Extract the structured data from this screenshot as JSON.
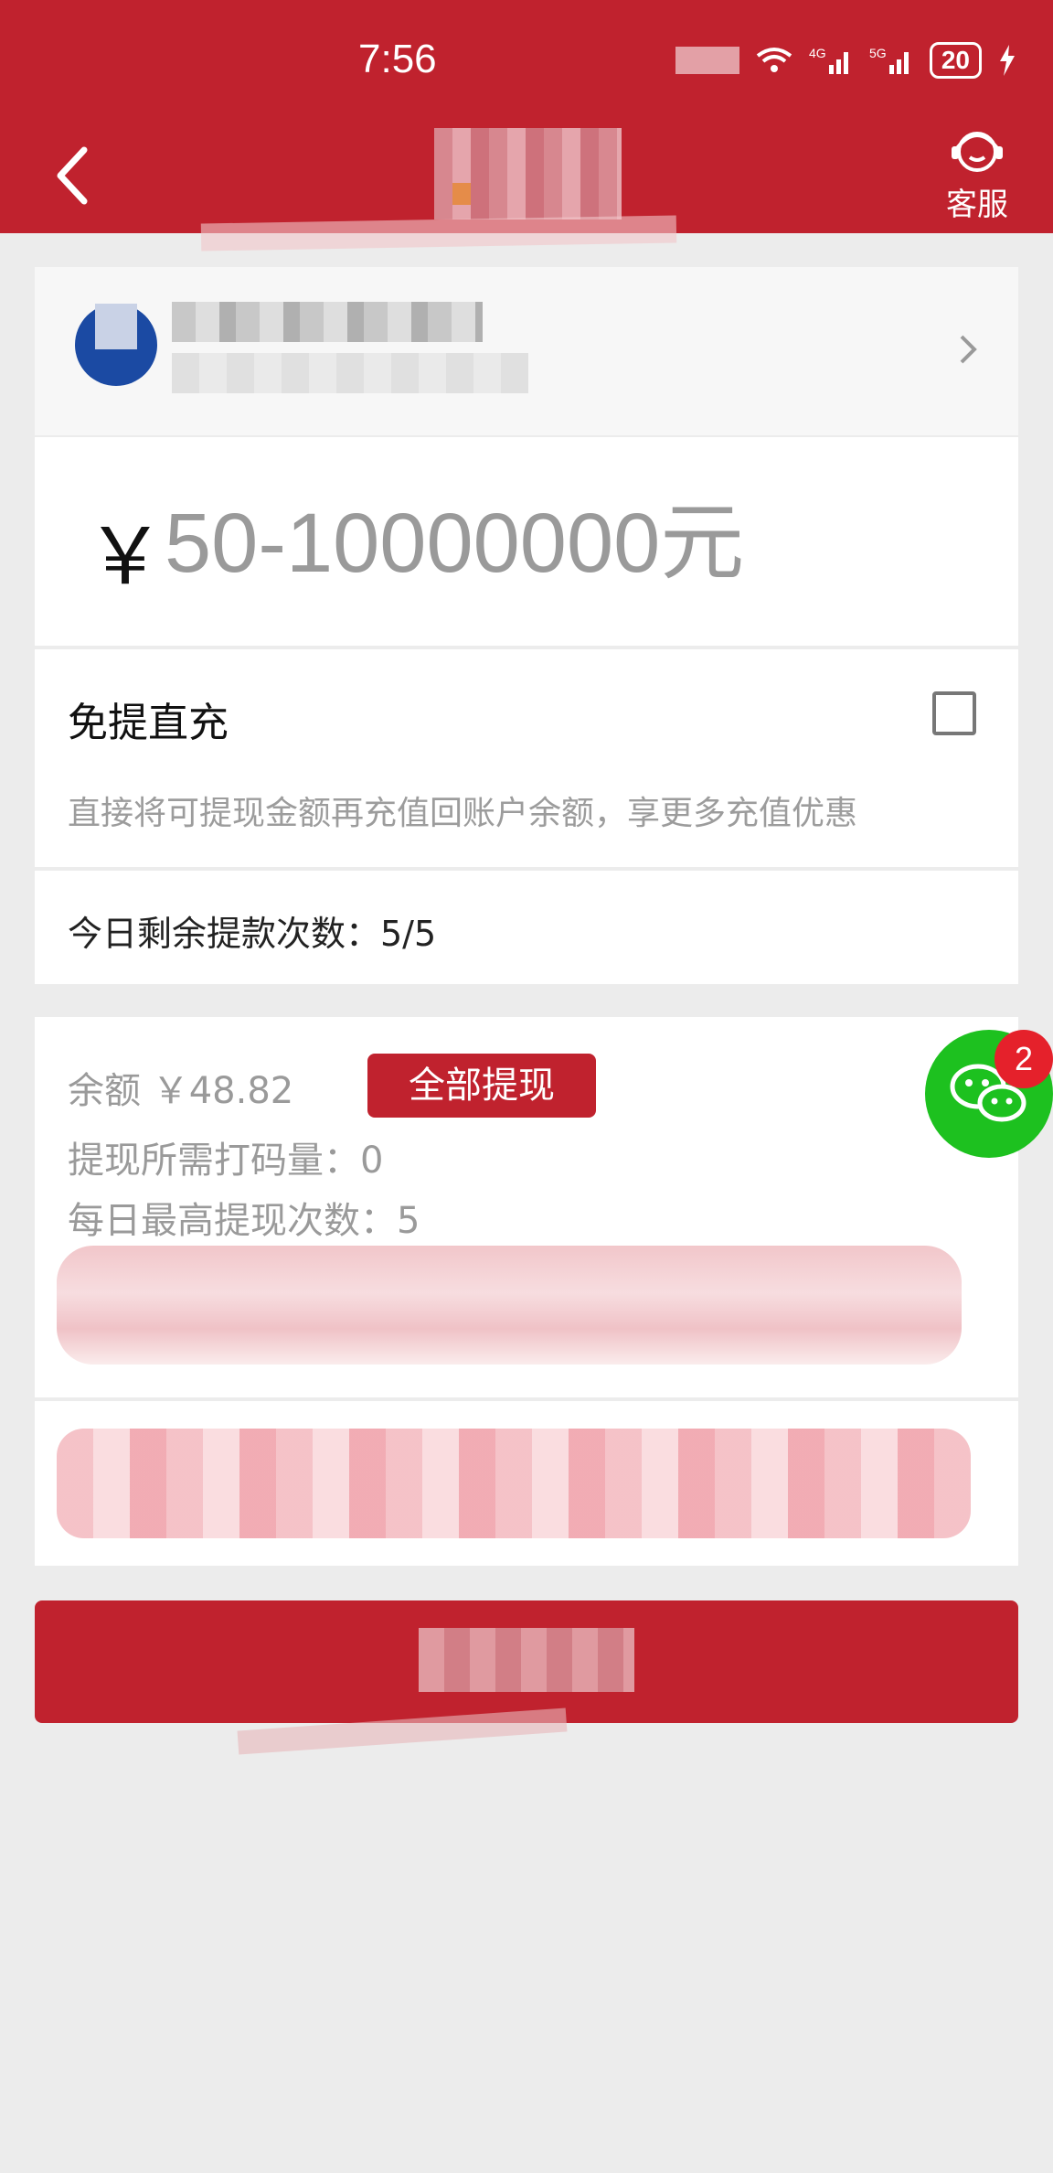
{
  "status_bar": {
    "time": "7:56",
    "battery": "20"
  },
  "nav": {
    "customer_service_label": "客服"
  },
  "amount": {
    "currency_symbol": "￥",
    "placeholder": "50-10000000元"
  },
  "direct_recharge": {
    "title": "免提直充",
    "description": "直接将可提现金额再充值回账户余额，享更多充值优惠",
    "checked": false
  },
  "remaining": {
    "text": "今日剩余提款次数：5/5"
  },
  "info": {
    "balance": "余额 ￥48.82",
    "withdraw_all_label": "全部提现",
    "required_turnover": "提现所需打码量：0",
    "daily_max": "每日最高提现次数：5"
  },
  "float": {
    "wechat_badge_count": "2"
  },
  "colors": {
    "brand_red": "#c0222e",
    "wechat_green": "#1dc11f",
    "badge_red": "#e5212b"
  }
}
